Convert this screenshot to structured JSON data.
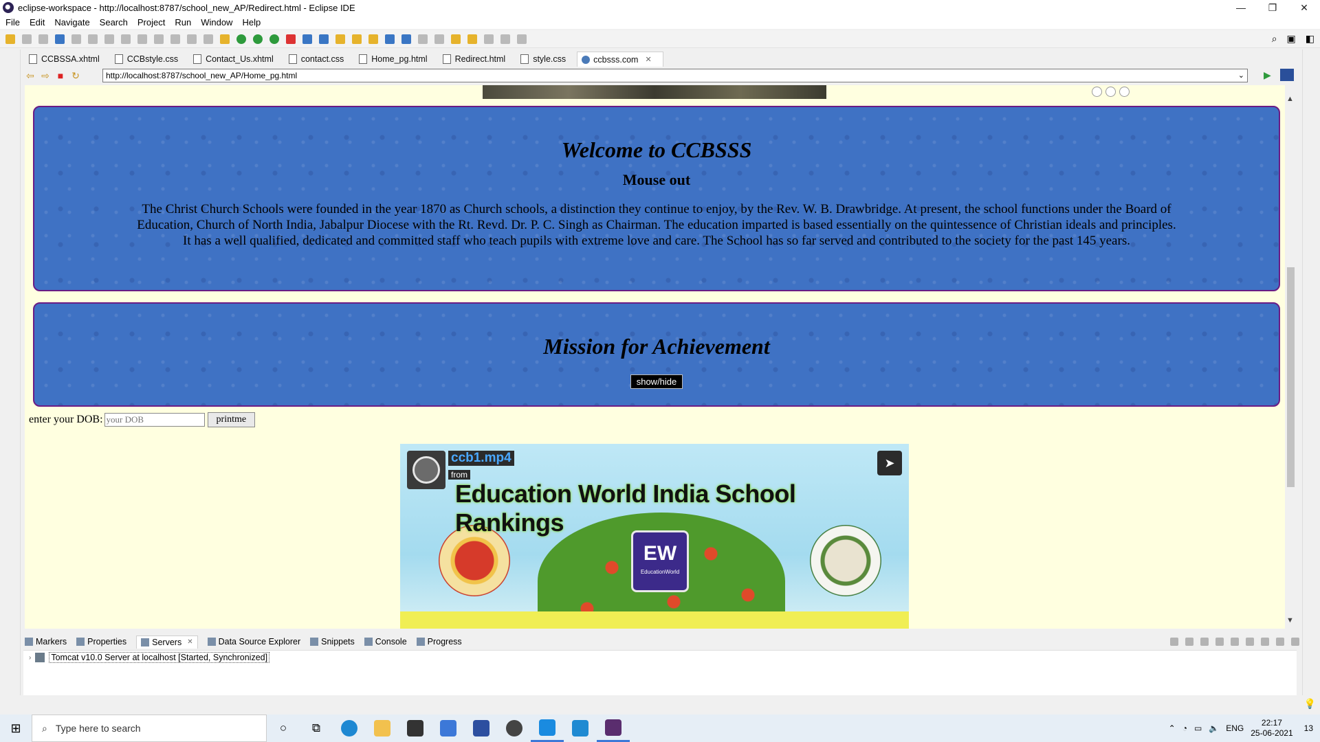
{
  "window": {
    "title": "eclipse-workspace - http://localhost:8787/school_new_AP/Redirect.html - Eclipse IDE",
    "minimize": "—",
    "maximize": "❐",
    "close": "✕"
  },
  "menu": [
    "File",
    "Edit",
    "Navigate",
    "Search",
    "Project",
    "Run",
    "Window",
    "Help"
  ],
  "editor_tabs": [
    {
      "label": "CCBSSA.xhtml",
      "active": false
    },
    {
      "label": "CCBstyle.css",
      "active": false
    },
    {
      "label": "Contact_Us.xhtml",
      "active": false
    },
    {
      "label": "contact.css",
      "active": false
    },
    {
      "label": "Home_pg.html",
      "active": false
    },
    {
      "label": "Redirect.html",
      "active": false
    },
    {
      "label": "style.css",
      "active": false
    },
    {
      "label": "ccbsss.com",
      "active": true
    }
  ],
  "browser": {
    "url": "http://localhost:8787/school_new_AP/Home_pg.html"
  },
  "page": {
    "welcome_title": "Welcome to CCBSSS",
    "welcome_subtitle": "Mouse out",
    "welcome_text": "The Christ Church Schools were founded in the year 1870 as Church schools, a distinction they continue to enjoy, by the Rev. W. B. Drawbridge. At present, the school functions under the Board of Education, Church of North India, Jabalpur Diocese with the Rt. Revd. Dr. P. C. Singh as Chairman. The education imparted is based essentially on the quintessence of Christian ideals and principles. It has a well qualified, dedicated and committed staff who teach pupils with extreme love and care. The School has so far served and contributed to the society for the past 145 years.",
    "mission_title": "Mission for Achievement",
    "show_hide_label": "show/hide",
    "dob_label": "enter your DOB:",
    "dob_placeholder": "your DOB",
    "print_button": "printme",
    "video": {
      "title": "ccb1.mp4",
      "from": "from",
      "headline": "Education World India School Rankings",
      "ew_badge": "EW",
      "ew_caption": "EducationWorld"
    }
  },
  "bottom_tabs": [
    {
      "label": "Markers",
      "active": false
    },
    {
      "label": "Properties",
      "active": false
    },
    {
      "label": "Servers",
      "active": true
    },
    {
      "label": "Data Source Explorer",
      "active": false
    },
    {
      "label": "Snippets",
      "active": false
    },
    {
      "label": "Console",
      "active": false
    },
    {
      "label": "Progress",
      "active": false
    }
  ],
  "servers": [
    {
      "label": "Tomcat v10.0 Server at localhost  [Started, Synchronized]"
    }
  ],
  "taskbar": {
    "search_placeholder": "Type here to search",
    "language": "ENG",
    "time": "22:17",
    "date": "25-06-2021",
    "notifications": "13"
  }
}
